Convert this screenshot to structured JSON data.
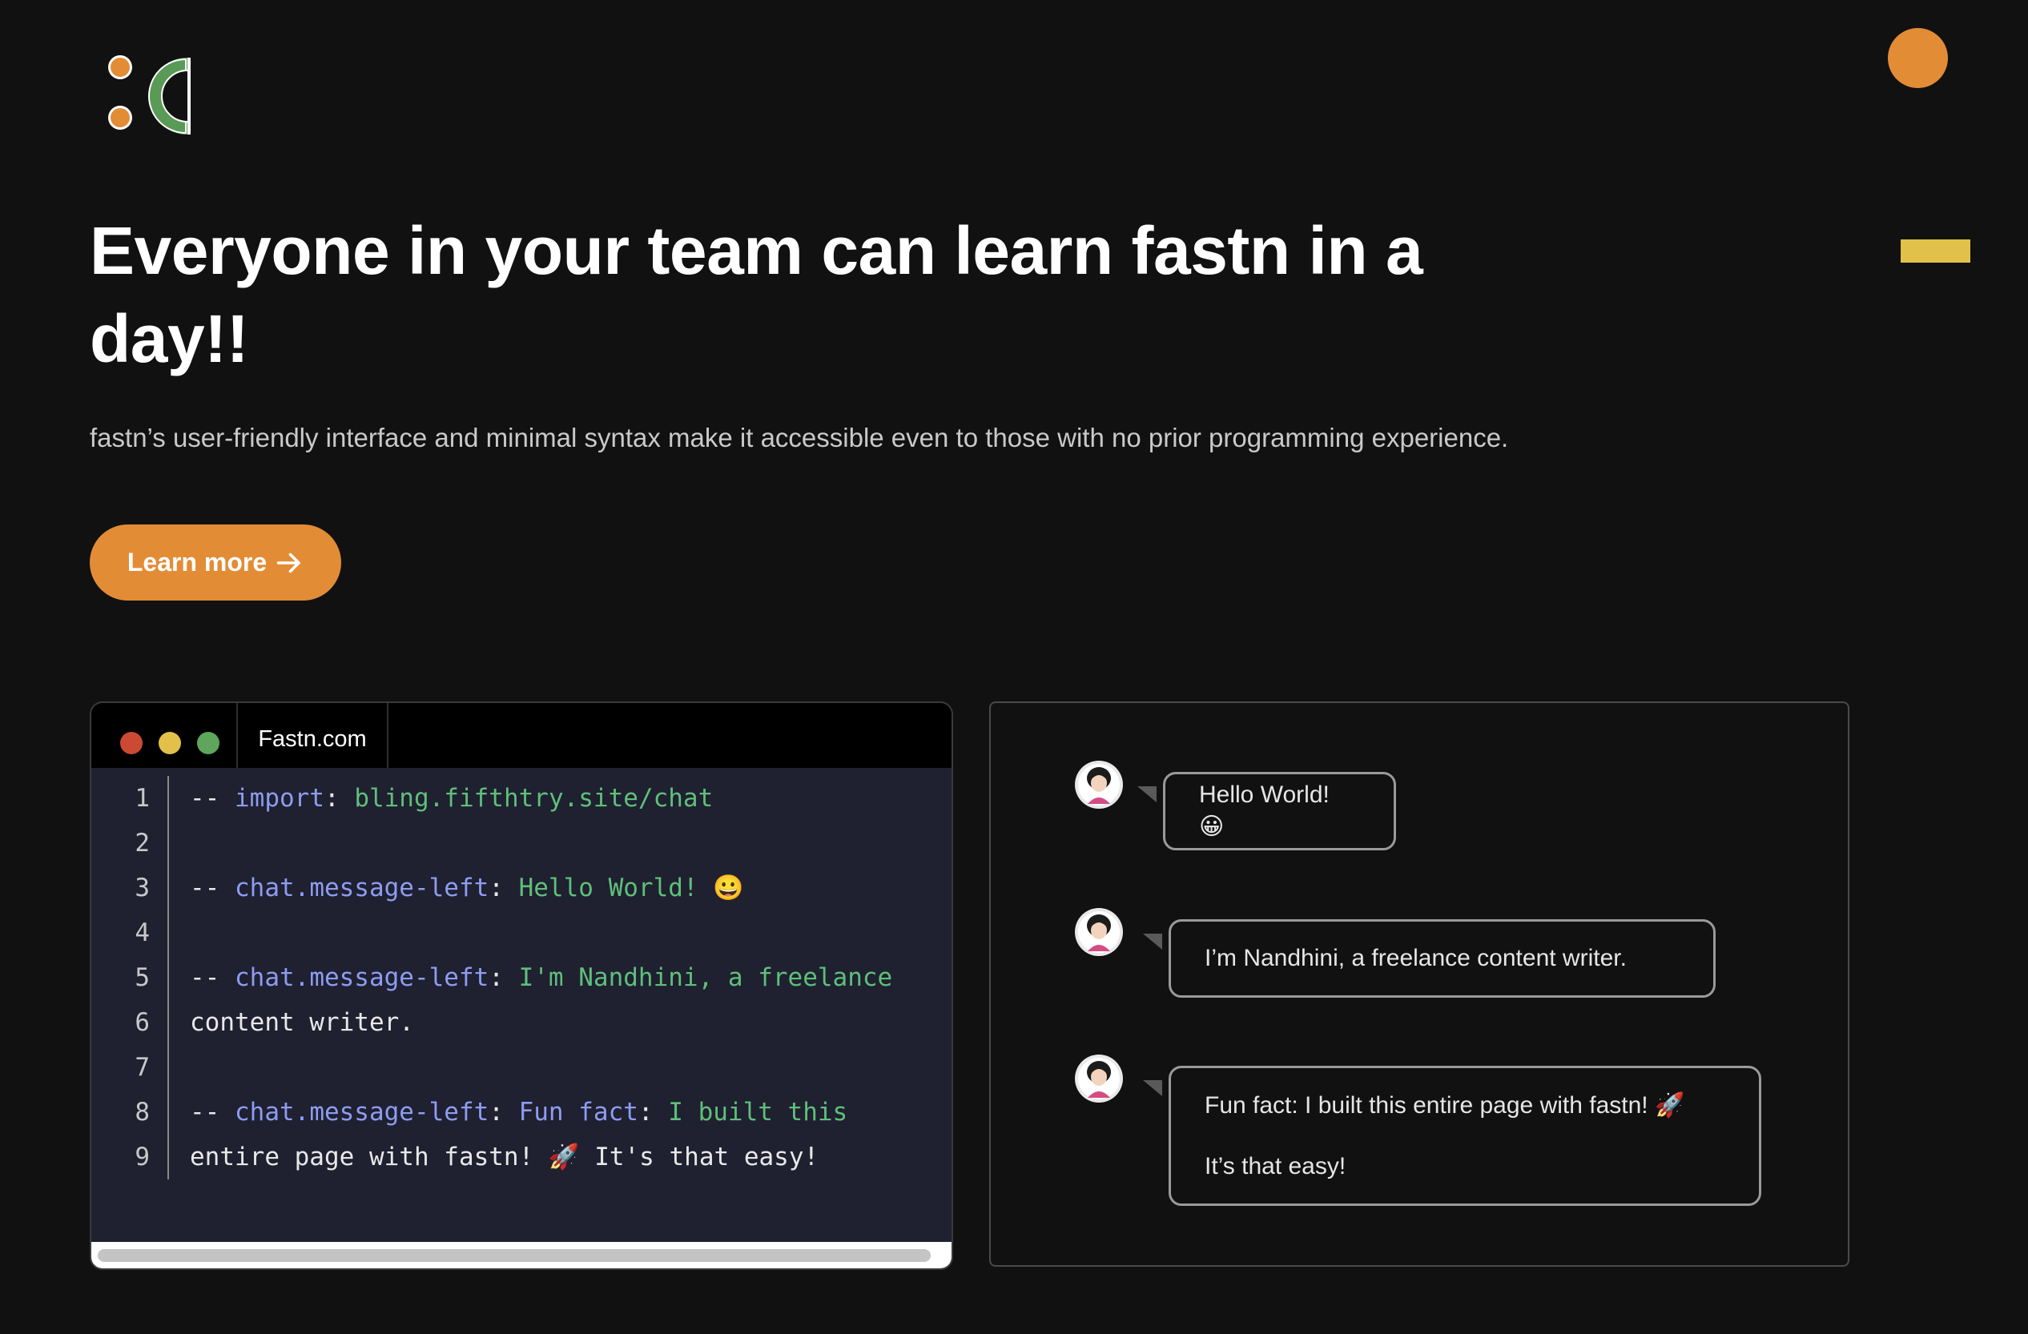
{
  "hero": {
    "title": "Everyone in your team can learn fastn in a day!!",
    "subtitle": "fastn’s user-friendly interface and minimal syntax make it accessible even to those with no prior programming experience.",
    "cta_label": "Learn more"
  },
  "colors": {
    "accent": "#e38c36",
    "decoration_yellow": "#e2c14a",
    "logo_green": "#5a9a57",
    "background": "#111111"
  },
  "code_window": {
    "tab_title": "Fastn.com",
    "line_numbers": [
      "1",
      "2",
      "3",
      "4",
      "5",
      "6",
      "7",
      "8",
      "9"
    ],
    "lines": [
      [
        {
          "t": "-- ",
          "c": "dash"
        },
        {
          "t": "import",
          "c": "kw"
        },
        {
          "t": ": ",
          "c": "plain"
        },
        {
          "t": "bling.fifthtry.site/chat",
          "c": "val"
        }
      ],
      [],
      [
        {
          "t": "-- ",
          "c": "dash"
        },
        {
          "t": "chat.message-left",
          "c": "kw"
        },
        {
          "t": ": ",
          "c": "plain"
        },
        {
          "t": "Hello World! 😀",
          "c": "val"
        }
      ],
      [],
      [
        {
          "t": "-- ",
          "c": "dash"
        },
        {
          "t": "chat.message-left",
          "c": "kw"
        },
        {
          "t": ": ",
          "c": "plain"
        },
        {
          "t": "I'm Nandhini, a freelance",
          "c": "val"
        }
      ],
      [
        {
          "t": "content writer.",
          "c": "plain"
        }
      ],
      [],
      [
        {
          "t": "-- ",
          "c": "dash"
        },
        {
          "t": "chat.message-left",
          "c": "kw"
        },
        {
          "t": ": ",
          "c": "plain"
        },
        {
          "t": "Fun fact",
          "c": "kw"
        },
        {
          "t": ": ",
          "c": "plain"
        },
        {
          "t": "I built this",
          "c": "val"
        }
      ],
      [
        {
          "t": "entire page with fastn! 🚀 It's that easy!",
          "c": "plain"
        }
      ]
    ]
  },
  "chat": {
    "messages": [
      {
        "paragraphs": [
          "Hello World! 😀"
        ]
      },
      {
        "paragraphs": [
          "I’m Nandhini, a freelance content writer."
        ]
      },
      {
        "paragraphs": [
          "Fun fact: I built this entire page with fastn! 🚀",
          "It’s that easy!"
        ]
      }
    ]
  }
}
